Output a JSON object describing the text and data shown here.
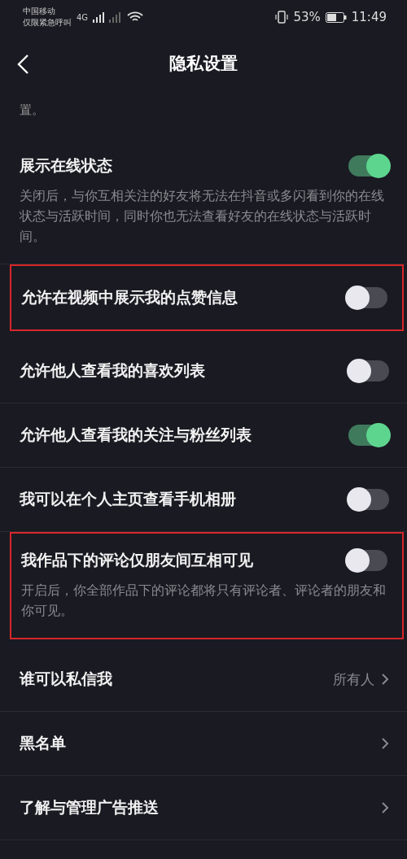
{
  "status_bar": {
    "carrier": "中国移动",
    "carrier_note": "仅限紧急呼叫",
    "network": "4G",
    "battery": "53%",
    "time": "11:49"
  },
  "header": {
    "title": "隐私设置"
  },
  "partial_text": "置。",
  "settings": [
    {
      "kind": "toggle",
      "title": "展示在线状态",
      "on": true,
      "highlighted": false,
      "description": "关闭后，与你互相关注的好友将无法在抖音或多闪看到你的在线状态与活跃时间，同时你也无法查看好友的在线状态与活跃时间。"
    },
    {
      "kind": "toggle",
      "title": "允许在视频中展示我的点赞信息",
      "on": false,
      "highlighted": true
    },
    {
      "kind": "toggle",
      "title": "允许他人查看我的喜欢列表",
      "on": false,
      "highlighted": false
    },
    {
      "kind": "toggle",
      "title": "允许他人查看我的关注与粉丝列表",
      "on": true,
      "highlighted": false
    },
    {
      "kind": "toggle",
      "title": "我可以在个人主页查看手机相册",
      "on": false,
      "highlighted": false
    },
    {
      "kind": "toggle",
      "title": "我作品下的评论仅朋友间互相可见",
      "on": false,
      "highlighted": true,
      "description": "开启后，你全部作品下的评论都将只有评论者、评论者的朋友和你可见。"
    },
    {
      "kind": "link",
      "title": "谁可以私信我",
      "value": "所有人"
    },
    {
      "kind": "link",
      "title": "黑名单"
    },
    {
      "kind": "link",
      "title": "了解与管理广告推送"
    }
  ]
}
